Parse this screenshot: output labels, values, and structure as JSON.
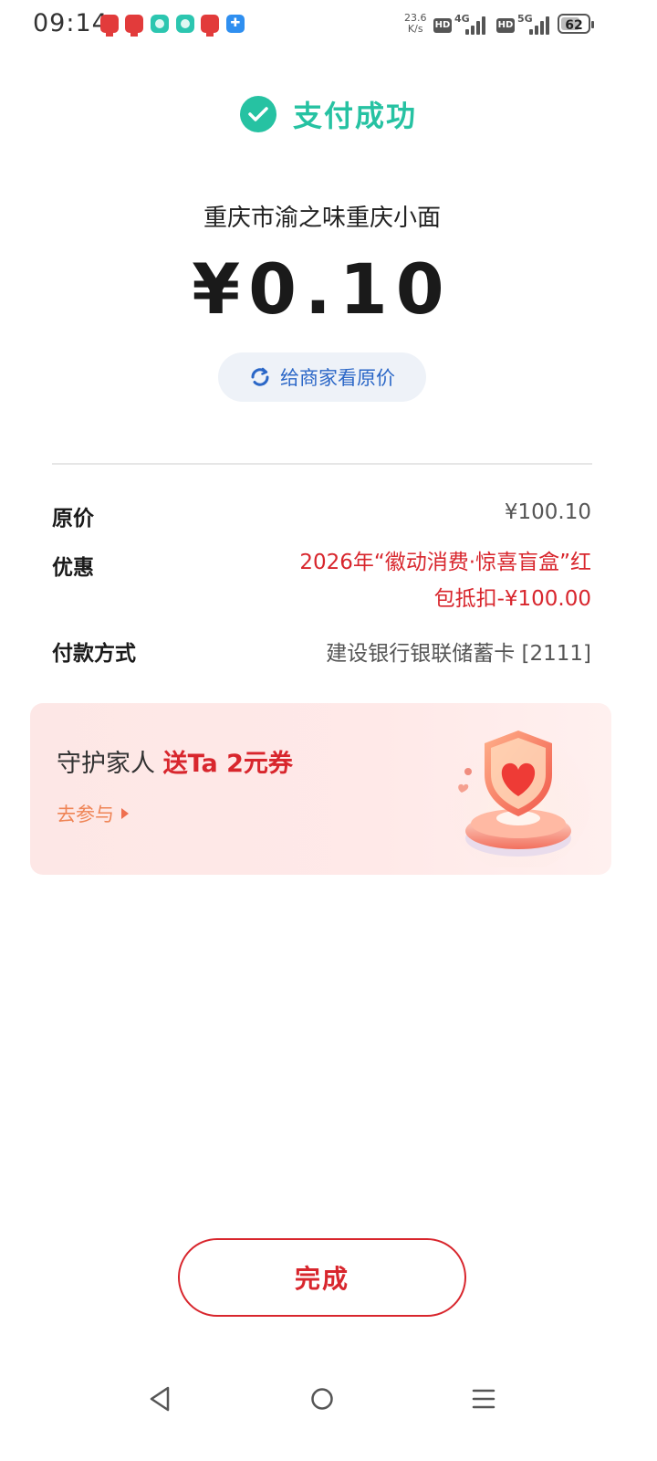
{
  "status_bar": {
    "time": "09:14",
    "net_speed_value": "23.6",
    "net_speed_unit": "K/s",
    "hd_label": "HD",
    "network_1": "4G",
    "network_2": "5G",
    "battery_level": "62"
  },
  "result": {
    "title": "支付成功",
    "merchant": "重庆市渝之味重庆小面",
    "amount": "¥0.10",
    "show_original_price_button": "给商家看原价"
  },
  "details": {
    "original_price_label": "原价",
    "original_price_value": "¥100.10",
    "discount_label": "优惠",
    "discount_value_line1": "2026年“徽动消费·惊喜盲盒”红",
    "discount_value_line2": "包抵扣-¥100.00",
    "payment_method_label": "付款方式",
    "payment_method_value": "建设银行银联储蓄卡 [2111]"
  },
  "promo": {
    "title_prefix": "守护家人 ",
    "title_highlight": "送Ta 2元券",
    "link": "去参与"
  },
  "done_button": "完成",
  "colors": {
    "success_green": "#26c2a2",
    "accent_red": "#d8262d",
    "link_blue": "#2b67c7"
  }
}
